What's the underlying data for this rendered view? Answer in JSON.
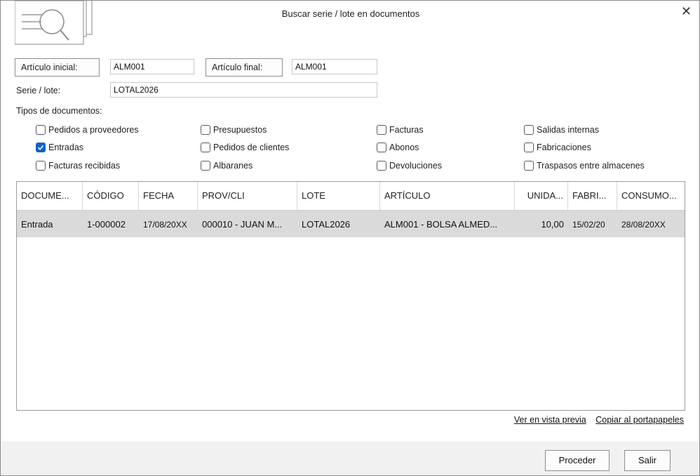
{
  "window": {
    "title": "Buscar serie / lote en documentos"
  },
  "filters": {
    "articulo_inicial_label": "Artículo inicial:",
    "articulo_inicial_value": "ALM001",
    "articulo_final_label": "Artículo final:",
    "articulo_final_value": "ALM001",
    "serie_label": "Serie / lote:",
    "serie_value": "LOTAL2026"
  },
  "doc_types": {
    "label": "Tipos de documentos:",
    "items": [
      {
        "label": "Pedidos a proveedores",
        "checked": false
      },
      {
        "label": "Entradas",
        "checked": true
      },
      {
        "label": "Facturas recibidas",
        "checked": false
      },
      {
        "label": "Presupuestos",
        "checked": false
      },
      {
        "label": "Pedidos de clientes",
        "checked": false
      },
      {
        "label": "Albaranes",
        "checked": false
      },
      {
        "label": "Facturas",
        "checked": false
      },
      {
        "label": "Abonos",
        "checked": false
      },
      {
        "label": "Devoluciones",
        "checked": false
      },
      {
        "label": "Salidas internas",
        "checked": false
      },
      {
        "label": "Fabricaciones",
        "checked": false
      },
      {
        "label": "Traspasos entre almacenes",
        "checked": false
      }
    ]
  },
  "table": {
    "columns": [
      "DOCUME...",
      "CÓDIGO",
      "FECHA",
      "PROV/CLI",
      "LOTE",
      "ARTÍCULO",
      "UNIDA...",
      "FABRI...",
      "CONSUMO..."
    ],
    "rows": [
      [
        "Entrada",
        "1-000002",
        "17/08/20XX",
        "000010 - JUAN M...",
        "LOTAL2026",
        "ALM001 - BOLSA ALMED...",
        "10,00",
        "15/02/20",
        "28/08/20XX"
      ]
    ]
  },
  "links": {
    "preview": "Ver en vista previa",
    "clipboard": "Copiar al portapapeles"
  },
  "buttons": {
    "proceed": "Proceder",
    "exit": "Salir"
  },
  "colors": {
    "accent": "#0b63c9",
    "row_selected": "#dadada",
    "footer": "#f1f1f1"
  }
}
